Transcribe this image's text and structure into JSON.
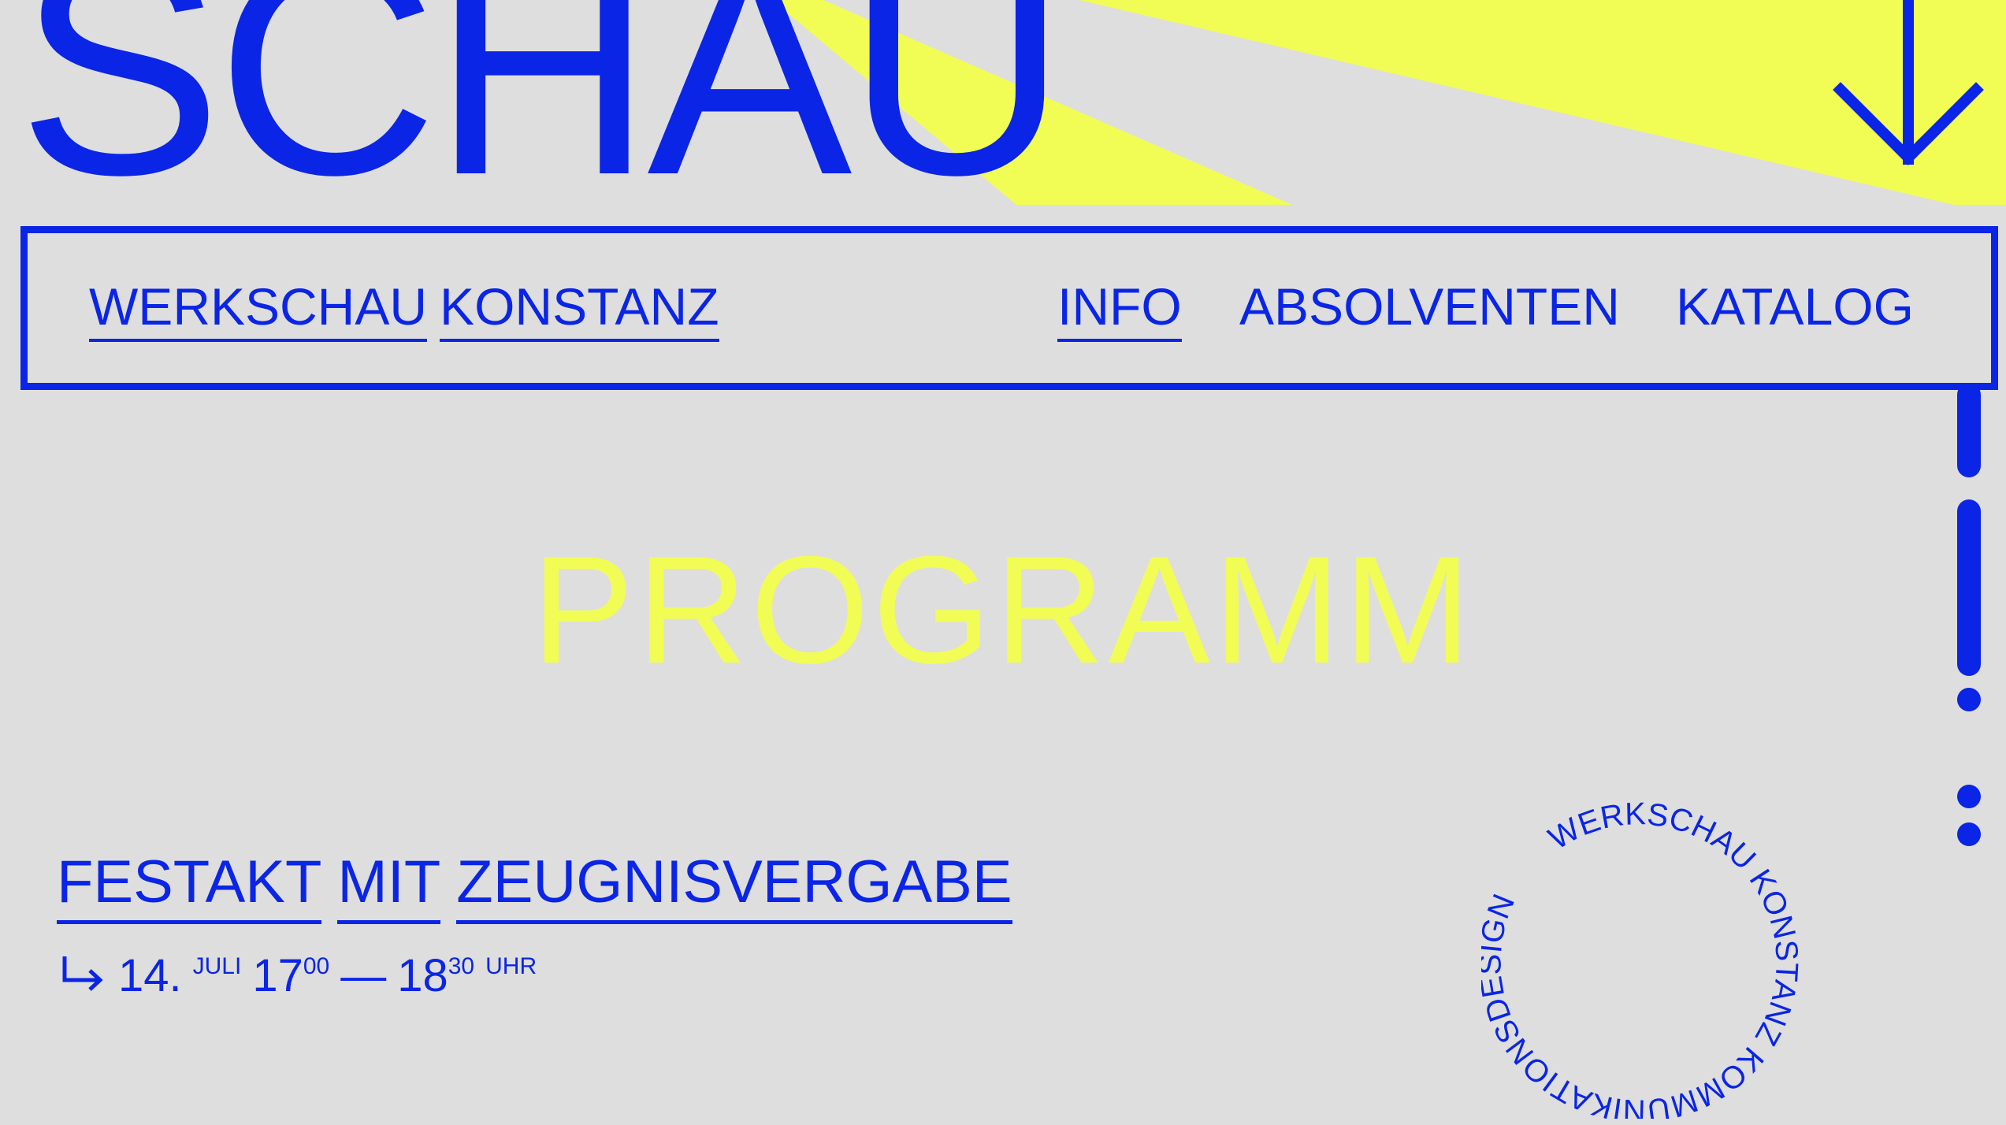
{
  "colors": {
    "background": "#dedede",
    "accent_blue": "#0b25e6",
    "accent_yellow": "#f1fd55"
  },
  "hero": {
    "word": "SCHAU"
  },
  "icons": {
    "scroll_down": "arrow-down-icon",
    "scroll_rail": "scroll-progress-rail",
    "date_prefix": "return-arrow-icon"
  },
  "nav": {
    "brand_word_1": "WERKSCHAU",
    "brand_word_2": "KONSTANZ",
    "items": [
      {
        "label": "INFO"
      },
      {
        "label": "ABSOLVENTEN"
      },
      {
        "label": "KATALOG"
      }
    ]
  },
  "section": {
    "title": "PROGRAMM"
  },
  "event": {
    "title_words": [
      "FESTAKT",
      "MIT",
      "ZEUGNISVERGABE"
    ],
    "day": "14.",
    "month": "JULI",
    "start_hour": "17",
    "start_minute": "00",
    "dash": "—",
    "end_hour": "18",
    "end_minute": "30",
    "suffix": "UHR"
  },
  "badge": {
    "ring_text": "WERKSCHAU KONSTANZ KOMMUNIKATIONSDESIGN"
  }
}
